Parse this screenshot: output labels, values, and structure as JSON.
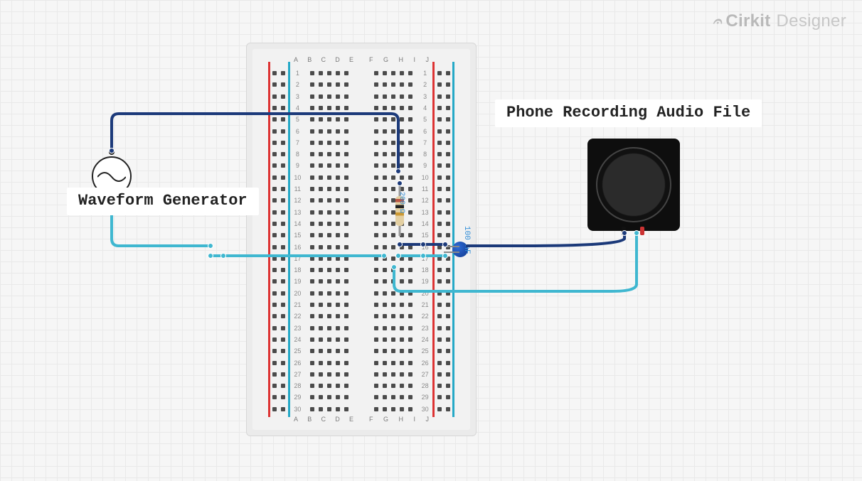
{
  "brand": {
    "name": "Cirkit",
    "tagline": "Designer"
  },
  "annotations": {
    "waveform_generator": "Waveform Generator",
    "phone_recording": "Phone Recording Audio File"
  },
  "components": {
    "resistor": {
      "value": "200 Ω",
      "name": "resistor"
    },
    "capacitor": {
      "value": "100 nF",
      "name": "capacitor"
    },
    "speaker": {
      "name": "speaker"
    },
    "waveform_generator": {
      "name": "waveform-generator"
    }
  },
  "breadboard": {
    "columns_left": [
      "A",
      "B",
      "C",
      "D",
      "E"
    ],
    "columns_right": [
      "F",
      "G",
      "H",
      "I",
      "J"
    ],
    "rows": 30
  },
  "wires": {
    "colors": {
      "signal": "#1c3a7a",
      "ground": "#3fb7d0"
    }
  }
}
